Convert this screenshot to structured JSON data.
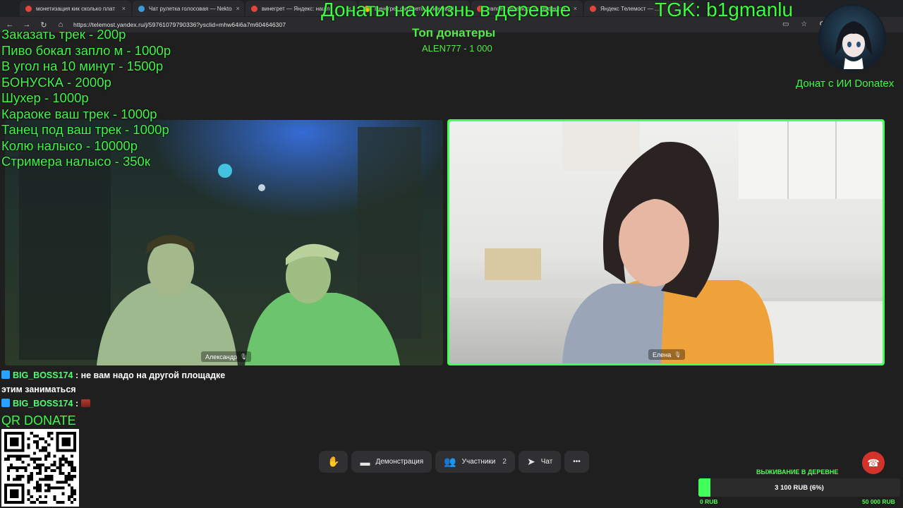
{
  "browser": {
    "tabs": [
      {
        "label": "монетизация кик сколько плат",
        "color": "#e0453a"
      },
      {
        "label": "Чат рулетка голосовая — Nekto",
        "color": "#3a9bd9"
      },
      {
        "label": "винегрет — Яндекс: нашл",
        "color": "#e0453a"
      },
      {
        "label": "Винегрет смотреть и скачивай",
        "color": "#f2c41d"
      },
      {
        "label": "yandex телемост — Яндекс: н",
        "color": "#e0453a"
      },
      {
        "label": "Яндекс Телемост — ...",
        "color": "#e0453a"
      }
    ],
    "url": "https://telemost.yandex.ru/j/59761079790336?ysclid=mhw64i6a7m604646307"
  },
  "overlay": {
    "headline": "Донаты на жизнь в деревне",
    "tgk": "TGK: b1gmanlu",
    "top_title": "Топ донатеры",
    "top_donor": "ALEN777 - 1 000",
    "ai_donate": "Донат с ИИ Donatex",
    "price_list": [
      "Заказать трек - 200р",
      "Пиво бокал запло м - 1000р",
      "В угол на 10 минут - 1500р",
      "БОНУСКА - 2000р",
      "Шухер - 1000р",
      "Караоке ваш трек - 1000р",
      "Танец под ваш трек - 1000р",
      "Колю налысо - 10000р",
      "Стримера налысо - 350к"
    ]
  },
  "participants": {
    "left_name": "Александр",
    "right_name": "Елена"
  },
  "chat": [
    {
      "user": "BIG_BOSS174",
      "sep": " : ",
      "text": "не вам надо на другой площадке этим заниматься"
    },
    {
      "user": "BIG_BOSS174",
      "sep": " : ",
      "text": ""
    }
  ],
  "qr_label": "QR DONATE",
  "controls": {
    "demo": "Демонстрация",
    "participants": "Участники",
    "participants_count": "2",
    "chat": "Чат",
    "more": "•••"
  },
  "goal": {
    "title": "ВЫЖИВАНИЕ В ДЕРЕВНЕ",
    "text": "3 100 RUB (6%)",
    "percent": 6,
    "min": "0 RUB",
    "max": "50 000 RUB"
  }
}
